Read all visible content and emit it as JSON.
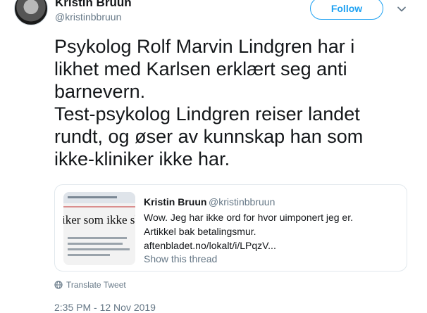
{
  "author": {
    "name": "Kristin Bruun",
    "handle": "@kristinbbruun",
    "follow_label": "Follow"
  },
  "tweet": {
    "lines": [
      "Psykolog Rolf Marvin Lindgren har i",
      "likhet med Karlsen erklært seg anti",
      "barnevern.",
      "Test-psykolog Lindgren reiser landet",
      "rundt, og øser av kunnskap han som",
      "ikke-kliniker ikke har."
    ]
  },
  "quote": {
    "name": "Kristin Bruun",
    "handle": "@kristinbbruun",
    "lines": [
      "Wow. Jeg har ikke ord for hvor uimponert jeg er.",
      "Artikkel bak betalingsmur.",
      "aftenbladet.no/lokalt/i/LPqzV..."
    ],
    "show_thread": "Show this thread",
    "thumbnail_headline": "iker som ikke skje"
  },
  "translate_label": "Translate Tweet",
  "timestamp": "2:35 PM - 12 Nov 2019",
  "icons": {
    "follow_menu": "chevron-down-icon",
    "translate": "globe-icon"
  },
  "colors": {
    "accent": "#1da1f2",
    "secondary_text": "#657786",
    "primary_text": "#14171a",
    "border": "#e1e8ed"
  }
}
